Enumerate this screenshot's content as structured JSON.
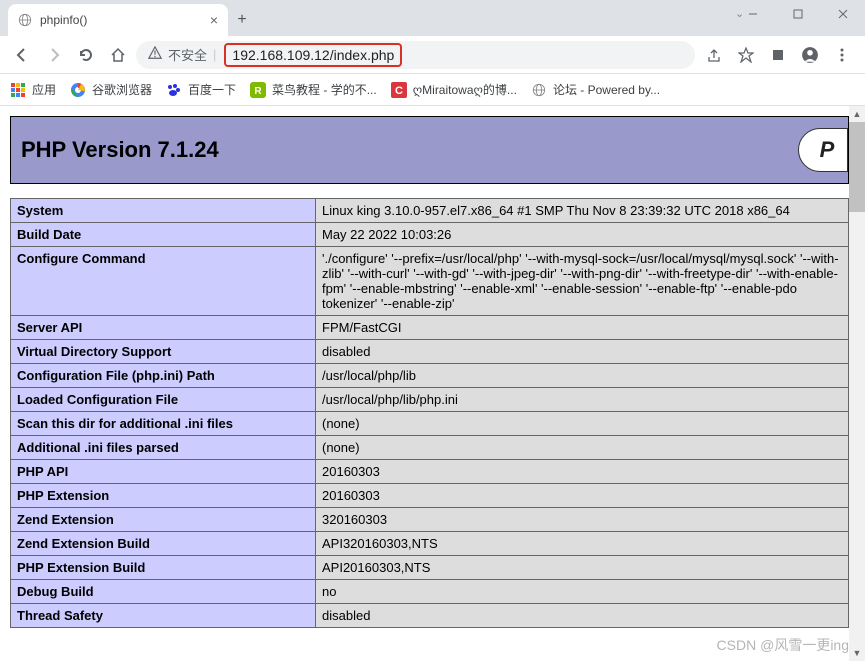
{
  "window": {
    "tab_title": "phpinfo()",
    "url_insecure_label": "不安全",
    "url": "192.168.109.12/index.php"
  },
  "bookmarks": {
    "apps": "应用",
    "items": [
      {
        "label": "谷歌浏览器"
      },
      {
        "label": "百度一下"
      },
      {
        "label": "菜鸟教程 - 学的不..."
      },
      {
        "label": "ღMiraitowaღ的博..."
      },
      {
        "label": "论坛 - Powered by..."
      }
    ]
  },
  "phpinfo": {
    "header": "PHP Version 7.1.24",
    "logo_text": "P",
    "rows": [
      {
        "k": "System",
        "v": "Linux king 3.10.0-957.el7.x86_64 #1 SMP Thu Nov 8 23:39:32 UTC 2018 x86_64"
      },
      {
        "k": "Build Date",
        "v": "May 22 2022 10:03:26"
      },
      {
        "k": "Configure Command",
        "v": "'./configure' '--prefix=/usr/local/php' '--with-mysql-sock=/usr/local/mysql/mysql.sock' '--with-zlib' '--with-curl' '--with-gd' '--with-jpeg-dir' '--with-png-dir' '--with-freetype-dir' '--with-enable-fpm' '--enable-mbstring' '--enable-xml' '--enable-session' '--enable-ftp' '--enable-pdo tokenizer' '--enable-zip'"
      },
      {
        "k": "Server API",
        "v": "FPM/FastCGI"
      },
      {
        "k": "Virtual Directory Support",
        "v": "disabled"
      },
      {
        "k": "Configuration File (php.ini) Path",
        "v": "/usr/local/php/lib"
      },
      {
        "k": "Loaded Configuration File",
        "v": "/usr/local/php/lib/php.ini"
      },
      {
        "k": "Scan this dir for additional .ini files",
        "v": "(none)"
      },
      {
        "k": "Additional .ini files parsed",
        "v": "(none)"
      },
      {
        "k": "PHP API",
        "v": "20160303"
      },
      {
        "k": "PHP Extension",
        "v": "20160303"
      },
      {
        "k": "Zend Extension",
        "v": "320160303"
      },
      {
        "k": "Zend Extension Build",
        "v": "API320160303,NTS"
      },
      {
        "k": "PHP Extension Build",
        "v": "API20160303,NTS"
      },
      {
        "k": "Debug Build",
        "v": "no"
      },
      {
        "k": "Thread Safety",
        "v": "disabled"
      }
    ]
  },
  "watermark": "CSDN @风雪一更ing"
}
